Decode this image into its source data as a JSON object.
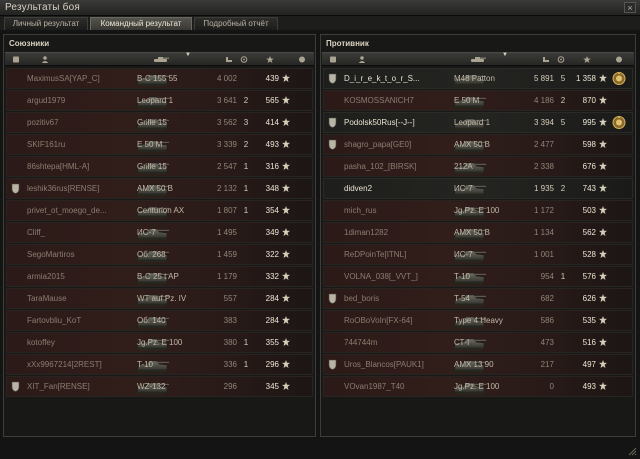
{
  "window": {
    "title": "Результаты боя",
    "close_glyph": "×"
  },
  "tabs": [
    {
      "label": "Личный результат",
      "active": false
    },
    {
      "label": "Командный результат",
      "active": true
    },
    {
      "label": "Подробный отчёт",
      "active": false
    }
  ],
  "allies": {
    "title": "Союзники",
    "rows": [
      {
        "player": "MaximusSA[YAP_C]",
        "tank": "B-C 155 55",
        "damage": "4 002",
        "kills": "",
        "xp": "439",
        "dead": true,
        "platoon": false
      },
      {
        "player": "argud1979",
        "tank": "Leopard 1",
        "damage": "3 641",
        "kills": "2",
        "xp": "565",
        "dead": true,
        "platoon": false
      },
      {
        "player": "pozitiv67",
        "tank": "Grille 15",
        "damage": "3 562",
        "kills": "3",
        "xp": "414",
        "dead": true,
        "platoon": false
      },
      {
        "player": "SKIF161ru",
        "tank": "E 50 M",
        "damage": "3 339",
        "kills": "2",
        "xp": "493",
        "dead": true,
        "platoon": false
      },
      {
        "player": "86shtepa[HML-A]",
        "tank": "Grille 15",
        "damage": "2 547",
        "kills": "1",
        "xp": "316",
        "dead": true,
        "platoon": false
      },
      {
        "player": "leshik36rus[RENSE]",
        "tank": "AMX 50 B",
        "damage": "2 132",
        "kills": "1",
        "xp": "348",
        "dead": true,
        "platoon": true
      },
      {
        "player": "privet_ot_moego_de...",
        "tank": "Centurion AX",
        "damage": "1 807",
        "kills": "1",
        "xp": "354",
        "dead": true,
        "platoon": false
      },
      {
        "player": "Cliff_",
        "tank": "ИС-7",
        "damage": "1 495",
        "kills": "",
        "xp": "349",
        "dead": true,
        "platoon": false
      },
      {
        "player": "SegoMartiros",
        "tank": "Об. 268",
        "damage": "1 459",
        "kills": "",
        "xp": "322",
        "dead": true,
        "platoon": false
      },
      {
        "player": "armia2015",
        "tank": "B-C 25 t AP",
        "damage": "1 179",
        "kills": "",
        "xp": "332",
        "dead": true,
        "platoon": false
      },
      {
        "player": "TaraMause",
        "tank": "WT auf Pz. IV",
        "damage": "557",
        "kills": "",
        "xp": "284",
        "dead": true,
        "platoon": false
      },
      {
        "player": "Fartovbliu_KoT",
        "tank": "Об. 140",
        "damage": "383",
        "kills": "",
        "xp": "284",
        "dead": true,
        "platoon": false
      },
      {
        "player": "kotoffey",
        "tank": "Jg.Pz. E 100",
        "damage": "380",
        "kills": "1",
        "xp": "355",
        "dead": true,
        "platoon": false
      },
      {
        "player": "xXx9967214[2REST]",
        "tank": "T-10",
        "damage": "336",
        "kills": "1",
        "xp": "296",
        "dead": true,
        "platoon": false
      },
      {
        "player": "XIT_Fan[RENSE]",
        "tank": "WZ-132",
        "damage": "296",
        "kills": "",
        "xp": "345",
        "dead": true,
        "platoon": true
      }
    ]
  },
  "enemies": {
    "title": "Противник",
    "rows": [
      {
        "player": "D_i_r_e_k_t_o_r_S...",
        "tank": "M48 Patton",
        "damage": "5 891",
        "kills": "5",
        "xp": "1 358",
        "dead": false,
        "platoon": true,
        "medal": true
      },
      {
        "player": "KOSMOSSANICH7",
        "tank": "E 50 M",
        "damage": "4 186",
        "kills": "2",
        "xp": "870",
        "dead": true,
        "platoon": false,
        "medal": false
      },
      {
        "player": "Podolsk50Rus[--J--]",
        "tank": "Leopard 1",
        "damage": "3 394",
        "kills": "5",
        "xp": "995",
        "dead": false,
        "platoon": true,
        "medal": true
      },
      {
        "player": "shagro_papa[GE0]",
        "tank": "AMX 50 B",
        "damage": "2 477",
        "kills": "",
        "xp": "598",
        "dead": true,
        "platoon": true,
        "medal": false
      },
      {
        "player": "pasha_102_[BIRSK]",
        "tank": "212A",
        "damage": "2 338",
        "kills": "",
        "xp": "676",
        "dead": true,
        "platoon": false,
        "medal": false
      },
      {
        "player": "didven2",
        "tank": "ИС-7",
        "damage": "1 935",
        "kills": "2",
        "xp": "743",
        "dead": false,
        "platoon": false,
        "medal": false
      },
      {
        "player": "mich_rus",
        "tank": "Jg.Pz. E 100",
        "damage": "1 172",
        "kills": "",
        "xp": "503",
        "dead": true,
        "platoon": false,
        "medal": false
      },
      {
        "player": "1diman1282",
        "tank": "AMX 50 B",
        "damage": "1 134",
        "kills": "",
        "xp": "562",
        "dead": true,
        "platoon": false,
        "medal": false
      },
      {
        "player": "ReDPoinTe[ITNL]",
        "tank": "ИС-7",
        "damage": "1 001",
        "kills": "",
        "xp": "528",
        "dead": true,
        "platoon": false,
        "medal": false
      },
      {
        "player": "VOLNA_038[_VVT_]",
        "tank": "T-10",
        "damage": "954",
        "kills": "1",
        "xp": "576",
        "dead": true,
        "platoon": false,
        "medal": false
      },
      {
        "player": "bed_boris",
        "tank": "T-54",
        "damage": "682",
        "kills": "",
        "xp": "626",
        "dead": true,
        "platoon": true,
        "medal": false
      },
      {
        "player": "RoOBoVoIn[FX-64]",
        "tank": "Type 4 Heavy",
        "damage": "586",
        "kills": "",
        "xp": "535",
        "dead": true,
        "platoon": false,
        "medal": false
      },
      {
        "player": "744744m",
        "tank": "СТ-I",
        "damage": "473",
        "kills": "",
        "xp": "516",
        "dead": true,
        "platoon": false,
        "medal": false
      },
      {
        "player": "Uros_Blancos[PAUK1]",
        "tank": "AMX 13 90",
        "damage": "217",
        "kills": "",
        "xp": "497",
        "dead": true,
        "platoon": true,
        "medal": false
      },
      {
        "player": "VOvan1987_T40",
        "tank": "Jg.Pz. E 100",
        "damage": "0",
        "kills": "",
        "xp": "493",
        "dead": true,
        "platoon": false,
        "medal": false
      }
    ]
  },
  "columns": {
    "icons": [
      "squad-icon",
      "player-icon",
      "tank-icon",
      "damage-icon",
      "kills-icon",
      "xp-icon",
      "medal-icon"
    ],
    "sort_marker": "▼"
  },
  "colors": {
    "dead_row": "#2c1a18",
    "alive_row": "#22221f",
    "active_tab": "#54534d",
    "text": "#c9c0b0"
  }
}
